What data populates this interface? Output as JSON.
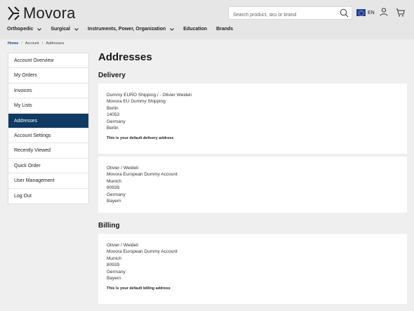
{
  "header": {
    "logo_text": "Movora",
    "search_placeholder": "Search product, sku or brand",
    "language": "EN",
    "nav": [
      {
        "label": "Orthopedic"
      },
      {
        "label": "Surgical"
      },
      {
        "label": "Instruments, Power, Organization"
      },
      {
        "label": "Education"
      },
      {
        "label": "Brands"
      }
    ]
  },
  "breadcrumb": [
    "Home",
    "Account",
    "Addresses"
  ],
  "sidebar": {
    "items": [
      {
        "label": "Account Overview"
      },
      {
        "label": "My Orders"
      },
      {
        "label": "Invoices"
      },
      {
        "label": "My Lists"
      },
      {
        "label": "Addresses"
      },
      {
        "label": "Account Settings"
      },
      {
        "label": "Recently Viewed"
      },
      {
        "label": "Quick Order"
      },
      {
        "label": "User Management"
      },
      {
        "label": "Log Out"
      }
    ],
    "active": "Addresses"
  },
  "main": {
    "title": "Addresses",
    "delivery": {
      "heading": "Delivery",
      "cards": [
        {
          "lines": [
            "Dummy EURO Shipping / - Olivier Weideli",
            "Movora EU Dummy Shipping",
            "Berlin",
            "14053",
            "Germany",
            "Berlin"
          ],
          "note": "This is your default delivery address"
        },
        {
          "lines": [
            "Olivier / Weideli",
            "Movora European Dummy Account",
            "Munich",
            "80939",
            "Germany",
            "Bayern"
          ],
          "note": ""
        }
      ]
    },
    "billing": {
      "heading": "Billing",
      "cards": [
        {
          "lines": [
            "Olivier / Weideli",
            "Movora European Dummy Account",
            "Munich",
            "80939",
            "Germany",
            "Bayern"
          ],
          "note": "This is your default billing address"
        }
      ]
    }
  },
  "colors": {
    "accent": "#0e3a63",
    "header_bg": "#e6e6e6",
    "page_bg": "#efefef"
  }
}
